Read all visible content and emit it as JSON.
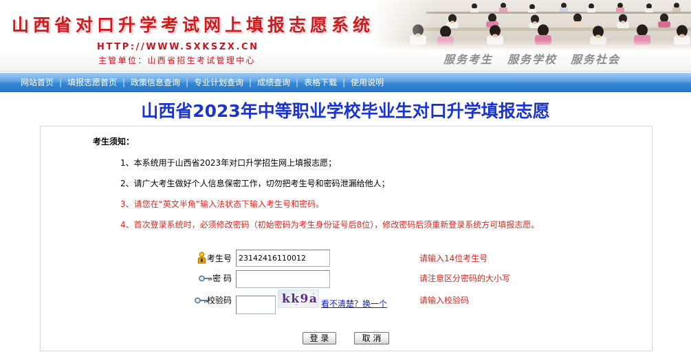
{
  "header": {
    "title": "山西省对口升学考试网上填报志愿系统",
    "url": "HTTP://WWW.SXKSZX.CN",
    "authority": "主管单位：山西省招生考试管理中心",
    "slogans": [
      "服务考生",
      "服务学校",
      "服务社会"
    ]
  },
  "nav": {
    "items": [
      "网站首页",
      "填报志愿首页",
      "政策信息查询",
      "专业计划查询",
      "成绩查询",
      "表格下载",
      "使用说明"
    ],
    "separator": "|"
  },
  "page_title": "山西省2023年中等职业学校毕业生对口升学填报志愿",
  "notice": {
    "heading": "考生须知：",
    "items": [
      {
        "text": "1、本系统用于山西省2023年对口升学招生网上填报志愿；",
        "color": "#000000"
      },
      {
        "text": "2、请广大考生做好个人信息保密工作，切勿把考生号和密码泄漏给他人；",
        "color": "#000000"
      },
      {
        "text": "3、请您在“英文半角”输入法状态下输入考生号和密码。",
        "color": "#e3261d"
      },
      {
        "text": "4、首次登录系统时，必须修改密码（初始密码为考生身份证号后8位），修改密码后须重新登录系统方可填报志愿。",
        "color": "#e3261d"
      }
    ]
  },
  "login_form": {
    "exam_id": {
      "label": "考生号",
      "value": "23142416110012",
      "hint": "请输入14位考生号",
      "icon": "user-icon"
    },
    "password": {
      "label": "密 码",
      "hint": "请注意区分密码的大小写",
      "icon": "key-icon"
    },
    "captcha": {
      "label": "校验码",
      "code": "kk9a",
      "refresh_link": "看不清楚？换一个",
      "hint": "请输入校验码",
      "icon": "key-icon"
    },
    "login_button": "登 录",
    "cancel_button": "取 消"
  },
  "colors": {
    "site_title": "#cf1a1f",
    "page_title": "#1a34cc",
    "hint": "#d9261c",
    "link": "#0a1fc7",
    "nav_bar": "#3186d8"
  }
}
